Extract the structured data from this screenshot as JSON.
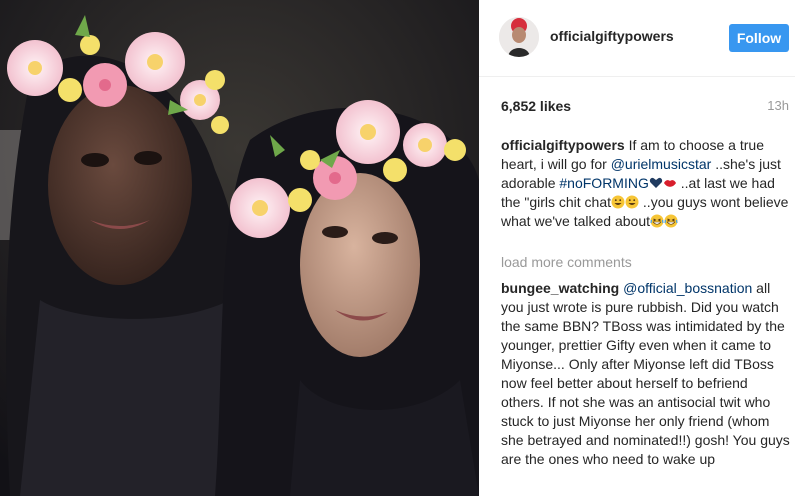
{
  "post": {
    "username": "officialgiftypowers",
    "follow_label": "Follow",
    "likes": "6,852 likes",
    "time": "13h"
  },
  "caption": {
    "username": "officialgiftypowers",
    "text1": "If am to choose a true heart, i will go for",
    "mention": "@urielmusicstar",
    "text2": "..she's just adorable",
    "hashtag": "#noFORMING",
    "text3": "..at last we had the \"girls chit chat",
    "text4": "..you guys wont believe what we've talked about"
  },
  "load_more": "load more comments",
  "comment": {
    "username": "bungee_watching",
    "mention": "@official_bossnation",
    "text": "all you just wrote is pure rubbish. Did you watch the same BBN? TBoss was intimidated by the younger, prettier Gifty even when it came to Miyonse... Only after Miyonse left did TBoss now feel better about herself to befriend others. If not she was an antisocial twit who stuck to just Miyonse her only friend (whom she betrayed and nominated!!) gosh! You guys are the ones who need to wake up"
  },
  "icons": [
    "heart-emoji-icon",
    "lips-emoji-icon",
    "grin-emoji-icon",
    "laugh-emoji-icon"
  ],
  "colors": {
    "follow": "#3897f0",
    "link": "#003569",
    "muted": "#999999"
  }
}
